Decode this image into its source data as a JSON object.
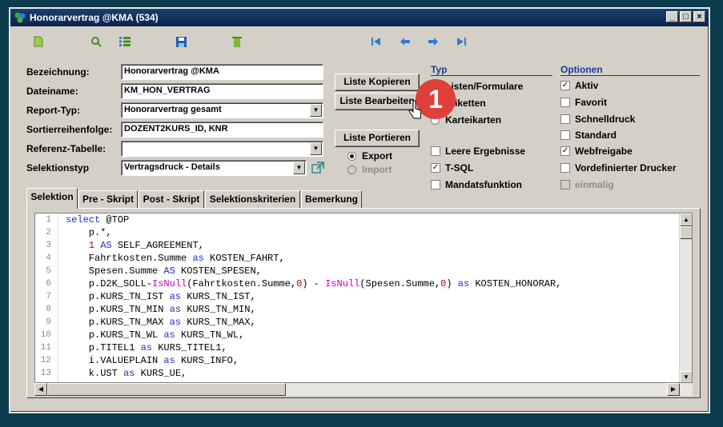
{
  "window": {
    "title": "Honorarvertrag @KMA (534)",
    "controls": [
      "_",
      "□",
      "×"
    ]
  },
  "toolbar": {
    "icons": [
      "new-document-icon",
      "search-icon",
      "list-icon",
      "save-icon",
      "delete-icon",
      "first-record-icon",
      "previous-record-icon",
      "next-record-icon",
      "last-record-icon"
    ]
  },
  "form": {
    "bezeichnung": {
      "label": "Bezeichnung:",
      "value": "Honorarvertrag @KMA"
    },
    "dateiname": {
      "label": "Dateiname:",
      "value": "KM_HON_VERTRAG"
    },
    "report_typ": {
      "label": "Report-Typ:",
      "value": "Honorarvertrag gesamt"
    },
    "sortierreihenfolge": {
      "label": "Sortierreihenfolge:",
      "value": "DOZENT2KURS_ID, KNR"
    },
    "referenz_tabelle": {
      "label": "Referenz-Tabelle:",
      "value": ""
    },
    "selektionstyp": {
      "label": "Selektionstyp",
      "value": "Vertragsdruck - Details"
    }
  },
  "buttons": {
    "liste_kopieren": "Liste Kopieren",
    "liste_bearbeiten": "Liste Bearbeiten",
    "liste_portieren": "Liste Portieren"
  },
  "radios": {
    "export": {
      "label": "Export",
      "selected": true
    },
    "import": {
      "label": "Import",
      "selected": false,
      "disabled": true
    }
  },
  "typ": {
    "header": "Typ",
    "items": [
      "Listen/Formulare",
      "Etiketten",
      "Karteikarten"
    ]
  },
  "typ_checks": [
    {
      "label": "Leere Ergebnisse",
      "checked": false
    },
    {
      "label": "T-SQL",
      "checked": true
    },
    {
      "label": "Mandatsfunktion",
      "checked": false
    }
  ],
  "optionen": {
    "header": "Optionen",
    "items": [
      {
        "label": "Aktiv",
        "checked": true
      },
      {
        "label": "Favorit",
        "checked": false
      },
      {
        "label": "Schnelldruck",
        "checked": false
      },
      {
        "label": "Standard",
        "checked": false
      },
      {
        "label": "Webfreigabe",
        "checked": true
      },
      {
        "label": "Vordefinierter Drucker",
        "checked": false
      },
      {
        "label": "einmalig",
        "checked": false,
        "disabled": true
      }
    ]
  },
  "tabs": [
    "Selektion",
    "Pre - Skript",
    "Post - Skript",
    "Selektionskriterien",
    "Bemerkung"
  ],
  "active_tab": "Selektion",
  "badge": "1",
  "code": {
    "line_numbers": [
      "1",
      "2",
      "3",
      "4",
      "5",
      "6",
      "7",
      "8",
      "9",
      "10",
      "11",
      "12",
      "13"
    ],
    "lines": [
      "select @TOP",
      "    p.*,",
      "    1 AS SELF_AGREEMENT,",
      "    Fahrtkosten.Summe as KOSTEN_FAHRT,",
      "    Spesen.Summe AS KOSTEN_SPESEN,",
      "    p.D2K_SOLL-IsNull(Fahrtkosten.Summe,0) - IsNull(Spesen.Summe,0) as KOSTEN_HONORAR,",
      "    p.KURS_TN_IST as KURS_TN_IST,",
      "    p.KURS_TN_MIN as KURS_TN_MIN,",
      "    p.KURS_TN_MAX as KURS_TN_MAX,",
      "    p.KURS_TN_WL as KURS_TN_WL,",
      "    p.TITEL1 as KURS_TITEL1,",
      "    i.VALUEPLAIN as KURS_INFO,",
      "    k.UST as KURS_UE,"
    ]
  }
}
